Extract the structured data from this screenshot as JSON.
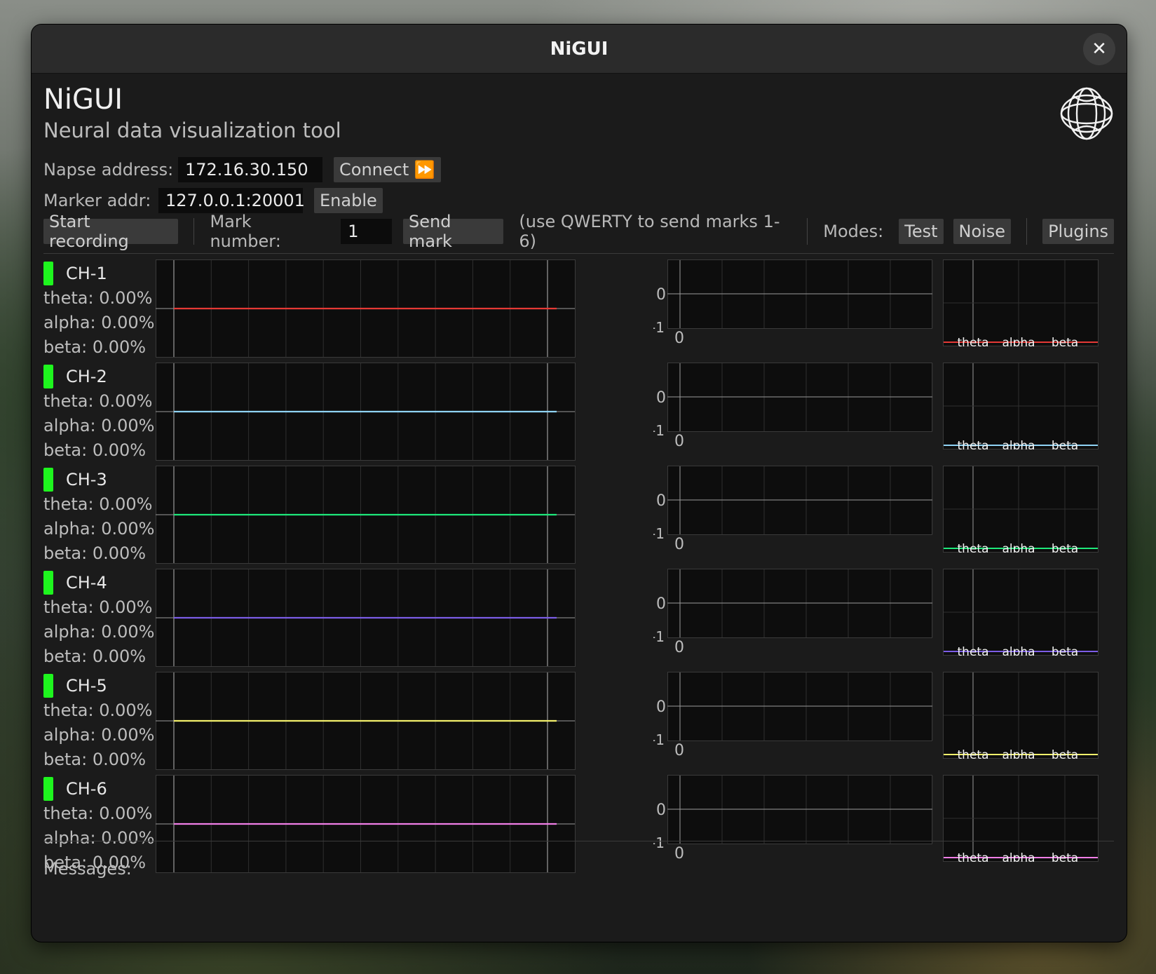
{
  "window": {
    "title": "NiGUI",
    "close_icon": "close-icon"
  },
  "header": {
    "app_name": "NiGUI",
    "subtitle": "Neural data visualization tool",
    "logo_icon": "brain-logo-icon"
  },
  "napse": {
    "label": "Napse address:",
    "value": "172.16.30.150",
    "connect_label": "Connect ⏩"
  },
  "marker": {
    "label": "Marker addr:",
    "value": "127.0.0.1:20001",
    "enable_label": "Enable"
  },
  "toolbar": {
    "start_recording": "Start recording",
    "mark_number_label": "Mark number:",
    "mark_number_value": "1",
    "send_mark": "Send mark",
    "hint": "(use QWERTY to send marks 1-6)",
    "modes_label": "Modes:",
    "test": "Test",
    "noise": "Noise",
    "plugins": "Plugins"
  },
  "channels": [
    {
      "name": "CH-1",
      "color": "#e53935",
      "theta": "theta: 0.00%",
      "alpha": "alpha: 0.00%",
      "beta": "beta: 0.00%"
    },
    {
      "name": "CH-2",
      "color": "#8fd3f4",
      "theta": "theta: 0.00%",
      "alpha": "alpha: 0.00%",
      "beta": "beta: 0.00%"
    },
    {
      "name": "CH-3",
      "color": "#1ee87a",
      "theta": "theta: 0.00%",
      "alpha": "alpha: 0.00%",
      "beta": "beta: 0.00%"
    },
    {
      "name": "CH-4",
      "color": "#7b5ce6",
      "theta": "theta: 0.00%",
      "alpha": "alpha: 0.00%",
      "beta": "beta: 0.00%"
    },
    {
      "name": "CH-5",
      "color": "#f3f06b",
      "theta": "theta: 0.00%",
      "alpha": "alpha: 0.00%",
      "beta": "beta: 0.00%"
    },
    {
      "name": "CH-6",
      "color": "#f07ee6",
      "theta": "theta: 0.00%",
      "alpha": "alpha: 0.00%",
      "beta": "beta: 0.00%"
    }
  ],
  "chart_data": [
    {
      "type": "line",
      "x": [
        0,
        10
      ],
      "series": [
        {
          "values": [
            0,
            0
          ]
        }
      ]
    },
    {
      "type": "line",
      "x": [
        0,
        10
      ],
      "series": [
        {
          "values": [
            0,
            0
          ]
        }
      ]
    },
    {
      "type": "line",
      "x": [
        0,
        10
      ],
      "series": [
        {
          "values": [
            0,
            0
          ]
        }
      ]
    },
    {
      "type": "line",
      "x": [
        0,
        10
      ],
      "series": [
        {
          "values": [
            0,
            0
          ]
        }
      ]
    },
    {
      "type": "line",
      "x": [
        0,
        10
      ],
      "series": [
        {
          "values": [
            0,
            0
          ]
        }
      ]
    },
    {
      "type": "line",
      "x": [
        0,
        10
      ],
      "series": [
        {
          "values": [
            0,
            0
          ]
        }
      ]
    },
    {
      "type": "line",
      "y_ticks": [
        "0",
        "-1"
      ],
      "x_ticks": [
        "0"
      ],
      "series": [
        {
          "values": [
            0,
            0
          ]
        }
      ]
    },
    {
      "type": "bar",
      "categories": [
        "theta",
        "alpha",
        "beta"
      ],
      "values": [
        0,
        0,
        0
      ]
    }
  ],
  "spectrum": {
    "y_tick_0": "0",
    "y_tick_neg1": "-1",
    "x_tick_0": "0"
  },
  "bands": {
    "theta": "theta",
    "alpha": "alpha",
    "beta": "beta"
  },
  "messages": {
    "label": "Messages:"
  }
}
